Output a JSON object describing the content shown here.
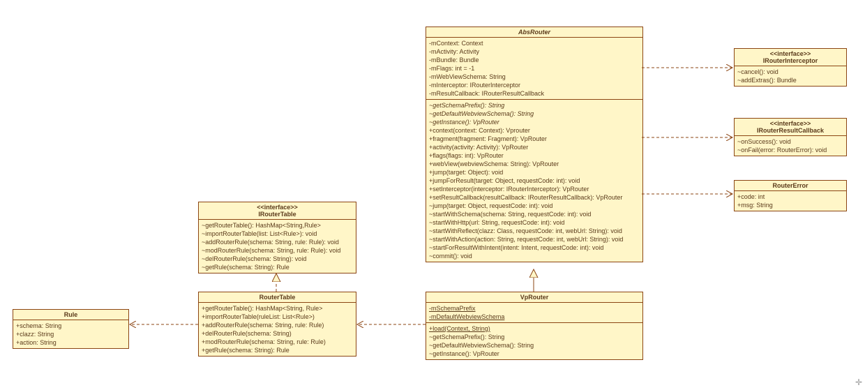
{
  "chart_data": {
    "type": "uml-class-diagram",
    "classes": [
      {
        "id": "IRouterInterceptor",
        "stereotype": "<<interface>>",
        "name": "IRouterInterceptor",
        "attributes": [],
        "operations": [
          "~cancel(): void",
          "~addExtras(): Bundle"
        ]
      },
      {
        "id": "IRouterResultCallback",
        "stereotype": "<<interface>>",
        "name": "IRouterResultCallback",
        "attributes": [],
        "operations": [
          "~onSuccess(): void",
          "~onFail(error: RouterError): void"
        ]
      },
      {
        "id": "RouterError",
        "stereotype": null,
        "name": "RouterError",
        "attributes": [
          "+code: int",
          "+msg: String"
        ],
        "operations": []
      },
      {
        "id": "AbsRouter",
        "stereotype": null,
        "name": "AbsRouter",
        "abstract": true,
        "attributes": [
          "-mContext: Context",
          "-mActivity: Activity",
          "-mBundle: Bundle",
          "-mFlags: int = -1",
          "-mWebViewSchema: String",
          "-mInterceptor: IRouterInterceptor",
          "-mResultCallback: IRouterResultCallback"
        ],
        "operations": [
          {
            "sig": "~getSchemaPrefix(): String",
            "abstract": true
          },
          {
            "sig": "~getDefaultWebviewSchema(): String",
            "abstract": true
          },
          {
            "sig": "~getInstance(): VpRouter",
            "abstract": true
          },
          {
            "sig": "+context(context: Context): Vprouter"
          },
          {
            "sig": "+fragment(fragment: Fragment): VpRouter"
          },
          {
            "sig": "+activity(activity: Activity): VpRouter"
          },
          {
            "sig": "+flags(flags: int): VpRouter"
          },
          {
            "sig": "+webView(webviewSchema: String): VpRouter"
          },
          {
            "sig": "+jump(target: Object): void"
          },
          {
            "sig": "+jumpForResult(target: Object, requestCode: int): void"
          },
          {
            "sig": "+setInterceptor(interceptor: IRouterInterceptor): VpRouter"
          },
          {
            "sig": "+setResultCallback(resultCallback: IRouterResultCallback): VpRouter"
          },
          {
            "sig": "~jump(target: Object, requestCode: int): void"
          },
          {
            "sig": "~startWithSchema(schema: String, requestCode: int): void"
          },
          {
            "sig": "~startWithHttp(url: String, requestCode: int): void"
          },
          {
            "sig": "~startWithReflect(clazz: Class, requestCode: int, webUrl: String): void"
          },
          {
            "sig": "~startWithAction(action: String, requestCode: int, webUrl: String): void"
          },
          {
            "sig": "~startForResultWithIntent(intent: Intent, requestCode: int): void"
          },
          {
            "sig": "~commit(): void"
          }
        ]
      },
      {
        "id": "VpRouter",
        "stereotype": null,
        "name": "VpRouter",
        "attributes": [
          {
            "sig": "-mSchemaPrefix",
            "static": true
          },
          {
            "sig": "-mDefaultWebviewSchema",
            "static": true
          }
        ],
        "operations": [
          {
            "sig": "+load(Context, String)",
            "static": true
          },
          {
            "sig": "~getSchemaPrefix(): String"
          },
          {
            "sig": "~getDefaultWebviewSchema(): String"
          },
          {
            "sig": "~getInstance(): VpRouter"
          }
        ]
      },
      {
        "id": "IRouterTable",
        "stereotype": "<<interface>>",
        "name": "IRouterTable",
        "attributes": [],
        "operations": [
          "~getRouterTable(): HashMap<String,Rule>",
          "~importRouterTable(list: List<Rule>): void",
          "~addRouterRule(schema: String, rule: Rule): void",
          "~modRouterRule(schema: String, rule: Rule): void",
          "~delRouterRule(schema: String): void",
          "~getRule(schema: String): Rule"
        ]
      },
      {
        "id": "RouterTable",
        "stereotype": null,
        "name": "RouterTable",
        "attributes": [],
        "operations": [
          "+getRouterTable(): HashMap<String, Rule>",
          "+importRouterTable(ruleList: List<Rule>)",
          "+addRouterRule(schema: String, rule: Rule)",
          "+delRouterRule(schema: String)",
          "+modRouterRule(schema: String, rule: Rule)",
          "+getRule(schema: String): Rule"
        ]
      },
      {
        "id": "Rule",
        "stereotype": null,
        "name": "Rule",
        "attributes": [
          "+schema: String",
          "+clazz: String",
          "+action: String"
        ],
        "operations": []
      }
    ],
    "relationships": [
      {
        "from": "VpRouter",
        "to": "AbsRouter",
        "type": "generalization"
      },
      {
        "from": "RouterTable",
        "to": "IRouterTable",
        "type": "realization"
      },
      {
        "from": "VpRouter",
        "to": "RouterTable",
        "type": "dependency"
      },
      {
        "from": "RouterTable",
        "to": "Rule",
        "type": "dependency"
      },
      {
        "from": "AbsRouter",
        "to": "IRouterInterceptor",
        "type": "dependency"
      },
      {
        "from": "AbsRouter",
        "to": "IRouterResultCallback",
        "type": "dependency"
      },
      {
        "from": "AbsRouter",
        "to": "RouterError",
        "type": "dependency"
      }
    ]
  }
}
